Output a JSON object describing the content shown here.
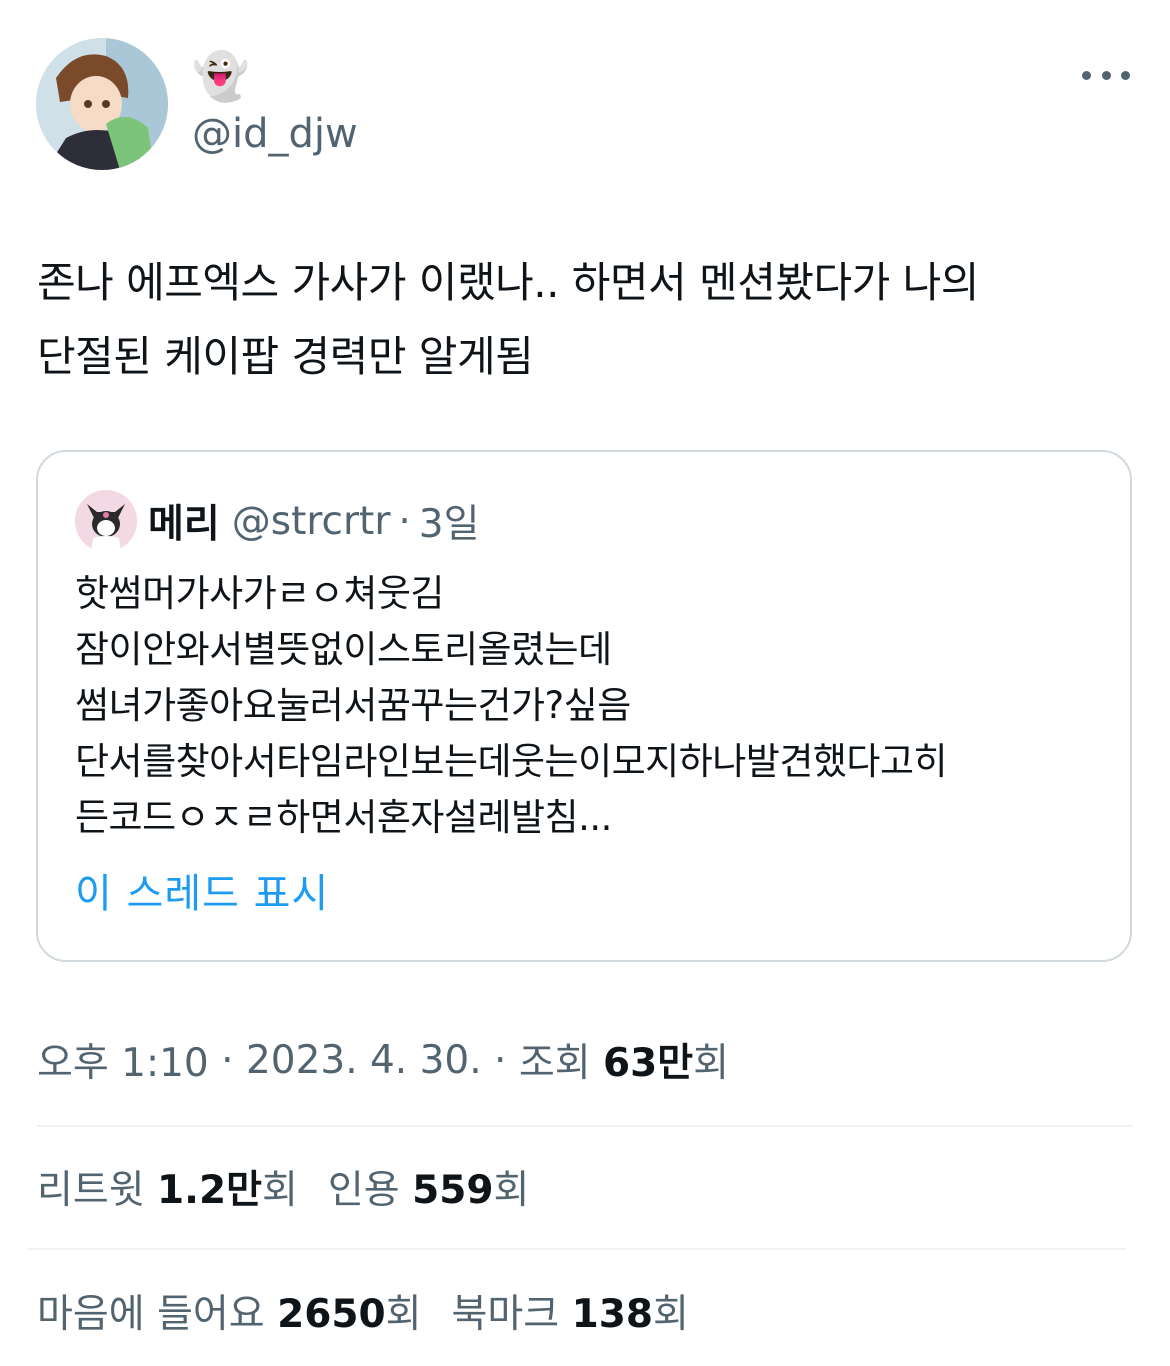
{
  "author": {
    "display_name": "👻",
    "handle": "@id_djw"
  },
  "tweet": {
    "lines": [
      "존나 에프엑스 가사가 이랬나.. 하면서 멘션봤다가 나의",
      "단절된 케이팝 경력만 알게됨"
    ]
  },
  "quote": {
    "name": "메리",
    "handle": "@strcrtr",
    "separator": "·",
    "time": "3일",
    "lines": [
      "핫썸머가사가ㄹㅇ쳐웃김",
      "잠이안와서별뜻없이스토리올렸는데",
      "썸녀가좋아요눌러서꿈꾸는건가?싶음",
      "단서를찾아서타임라인보는데웃는이모지하나발견했다고히",
      "든코드ㅇㅈㄹ하면서혼자설레발침..."
    ],
    "show_thread": "이 스레드 표시"
  },
  "meta": {
    "time": "오후 1:10",
    "separator1": " · ",
    "date": "2023. 4. 30.",
    "separator2": " · ",
    "views_label": "조회 ",
    "views_count": "63만",
    "views_suffix": "회"
  },
  "stats": {
    "retweet_label": "리트윗 ",
    "retweet_count": "1.2만",
    "retweet_suffix": "회",
    "quote_label": "인용 ",
    "quote_count": "559",
    "quote_suffix": "회",
    "like_label": "마음에 들어요 ",
    "like_count": "2650",
    "like_suffix": "회",
    "bookmark_label": "북마크 ",
    "bookmark_count": "138",
    "bookmark_suffix": "회"
  },
  "colors": {
    "text": "#0f1419",
    "secondary": "#536471",
    "link": "#1d9bf0",
    "border": "#cfd9de",
    "divider": "#eff3f4"
  },
  "icons": [
    "profile-avatar",
    "more-options-icon",
    "quote-avatar"
  ]
}
